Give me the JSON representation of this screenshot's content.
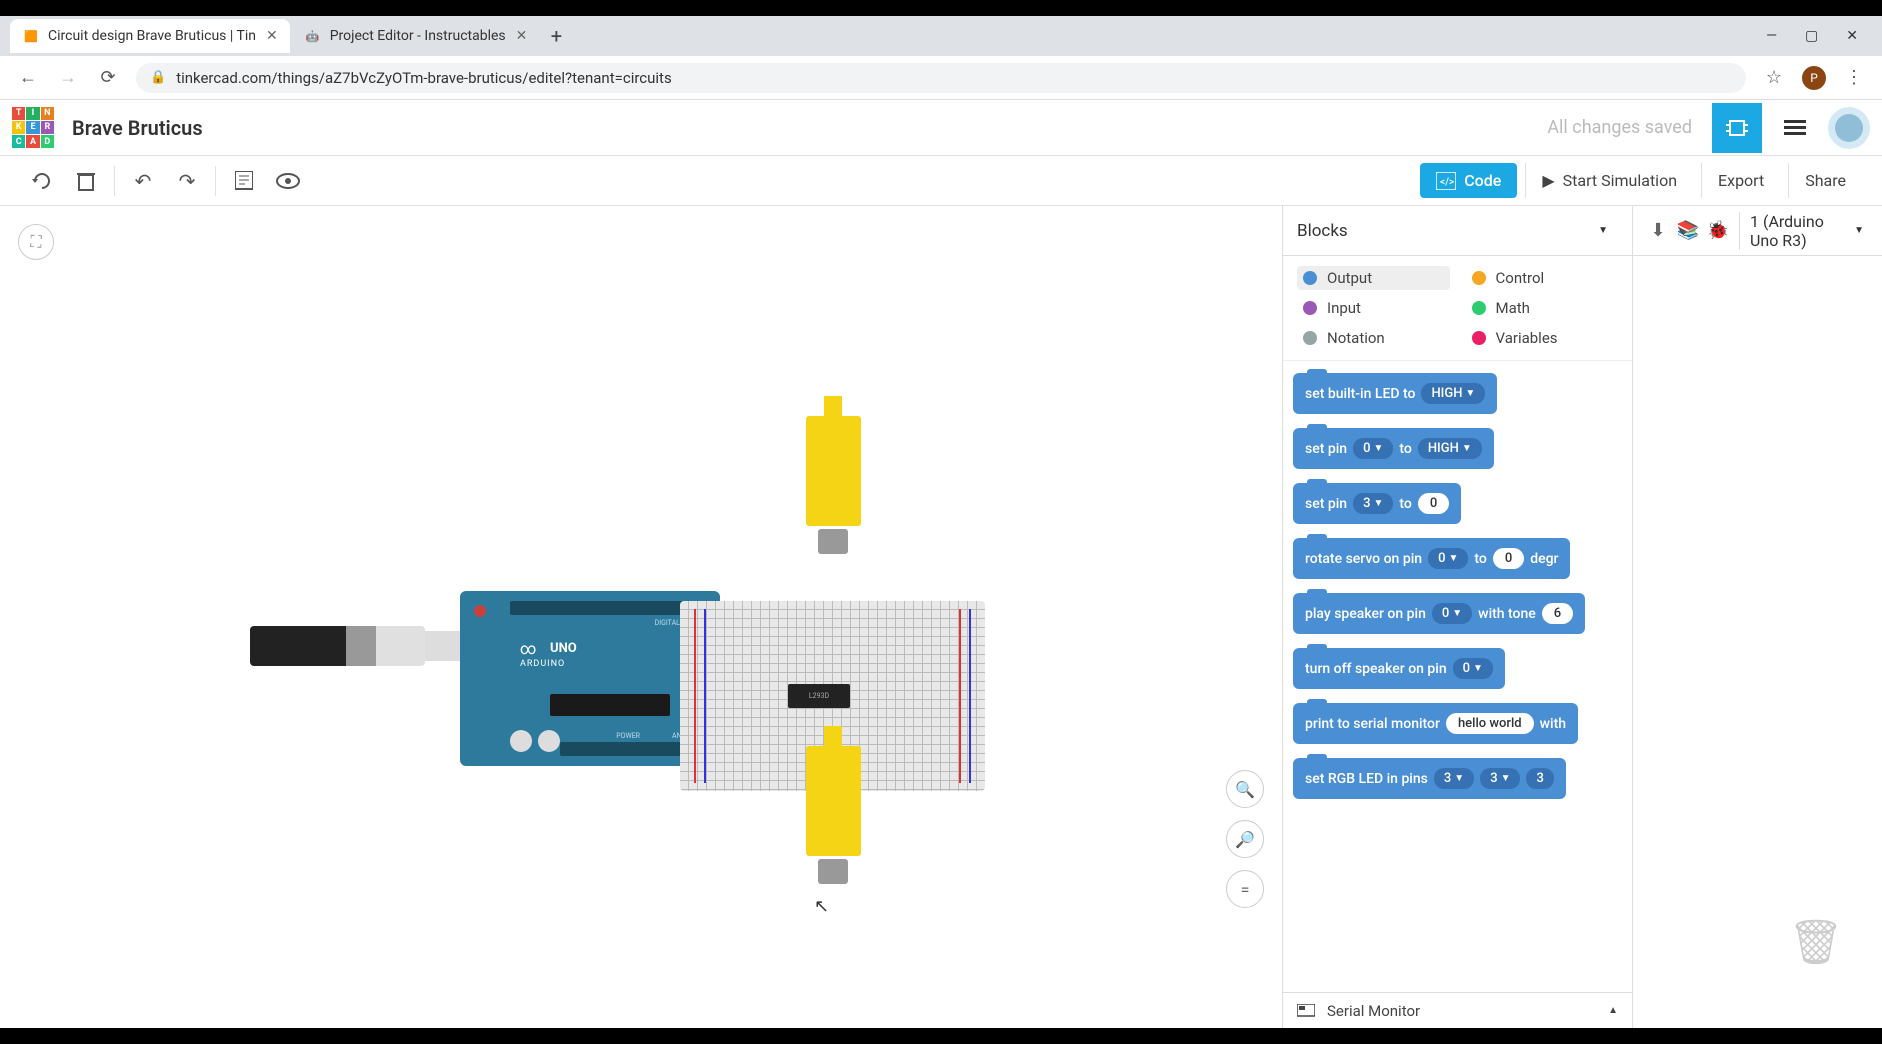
{
  "browser": {
    "tabs": [
      {
        "title": "Circuit design Brave Bruticus | Tin",
        "active": true
      },
      {
        "title": "Project Editor - Instructables",
        "active": false
      }
    ],
    "url": "tinkercad.com/things/aZ7bVcZyOTm-brave-bruticus/editel?tenant=circuits",
    "window_controls": {
      "min": "—",
      "max": "▢",
      "close": "✕"
    },
    "profile_initial": "P"
  },
  "header": {
    "logo_tiles": [
      "T",
      "I",
      "N",
      "K",
      "E",
      "R",
      "C",
      "A",
      "D"
    ],
    "logo_colors": [
      "#e74c3c",
      "#27ae60",
      "#e67e22",
      "#f1c40f",
      "#3498db",
      "#9b59b6",
      "#1abc9c",
      "#e74c3c",
      "#2ecc71"
    ],
    "project_title": "Brave Bruticus",
    "saved_status": "All changes saved"
  },
  "toolbar": {
    "code_label": "Code",
    "sim_label": "Start Simulation",
    "export_label": "Export",
    "share_label": "Share"
  },
  "code_panel": {
    "mode": "Blocks",
    "categories": [
      {
        "name": "Output",
        "color": "#4a8fd4",
        "active": true
      },
      {
        "name": "Control",
        "color": "#f5a623",
        "active": false
      },
      {
        "name": "Input",
        "color": "#9b59b6",
        "active": false
      },
      {
        "name": "Math",
        "color": "#2ecc71",
        "active": false
      },
      {
        "name": "Notation",
        "color": "#95a5a6",
        "active": false
      },
      {
        "name": "Variables",
        "color": "#e91e63",
        "active": false
      }
    ],
    "blocks": {
      "b1": {
        "label": "set built-in LED to",
        "f1": "HIGH"
      },
      "b2": {
        "label": "set pin",
        "f1": "0",
        "mid": "to",
        "f2": "HIGH"
      },
      "b3": {
        "label": "set pin",
        "f1": "3",
        "mid": "to",
        "f2": "0"
      },
      "b4": {
        "label": "rotate servo on pin",
        "f1": "0",
        "mid": "to",
        "f2": "0",
        "suffix": "degr"
      },
      "b5": {
        "label": "play speaker on pin",
        "f1": "0",
        "mid": "with tone",
        "f2": "6"
      },
      "b6": {
        "label": "turn off speaker on pin",
        "f1": "0"
      },
      "b7": {
        "label": "print to serial monitor",
        "f1": "hello world",
        "suffix": "with"
      },
      "b8": {
        "label": "set RGB LED in pins",
        "f1": "3",
        "f2": "3",
        "f3": "3"
      }
    },
    "serial_monitor": "Serial Monitor"
  },
  "device_panel": {
    "selected": "1 (Arduino Uno R3)"
  },
  "circuit": {
    "arduino_label": "UNO",
    "arduino_sub": "ARDUINO",
    "chip_label": "L293D"
  }
}
